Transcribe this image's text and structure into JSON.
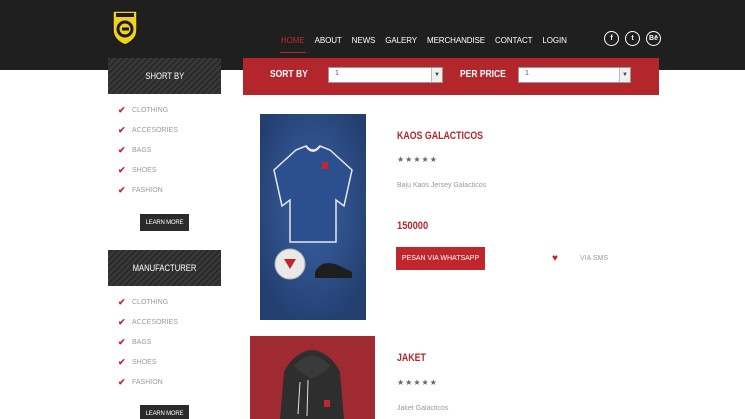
{
  "header": {
    "logo_icon": "shield-logo-icon",
    "nav": [
      {
        "label": "HOME",
        "active": true
      },
      {
        "label": "ABOUT",
        "active": false
      },
      {
        "label": "NEWS",
        "active": false
      },
      {
        "label": "GALERY",
        "active": false
      },
      {
        "label": "MERCHANDISE",
        "active": false
      },
      {
        "label": "CONTACT",
        "active": false
      },
      {
        "label": "LOGIN",
        "active": false
      }
    ],
    "social": [
      {
        "icon": "facebook-icon",
        "glyph": "f"
      },
      {
        "icon": "twitter-icon",
        "glyph": "t"
      },
      {
        "icon": "behance-icon",
        "glyph": "Bē"
      }
    ]
  },
  "sortbar": {
    "sort_label": "SORT BY",
    "sort_value": "1",
    "price_label": "PER PRICE",
    "price_value": "1"
  },
  "sidebar": {
    "short_by": {
      "title": "SHORT BY",
      "items": [
        "CLOTHING",
        "ACCESORIES",
        "BAGS",
        "SHOES",
        "FASHION"
      ],
      "button": "LEARN MORE"
    },
    "manufacturer": {
      "title": "MANUFACTURER",
      "items": [
        "CLOTHING",
        "ACCESORIES",
        "BAGS",
        "SHOES",
        "FASHION"
      ],
      "button": "LEARN MORE"
    }
  },
  "products": [
    {
      "title": "KAOS GALACTICOS",
      "stars": "★★★★★",
      "description": "Baju Kaos Jersey Galacticos",
      "price": "150000",
      "whatsapp_label": "PESAN VIA WHATSAPP",
      "sms_label": "VIA SMS"
    },
    {
      "title": "JAKET",
      "stars": "★★★★★",
      "description": "Jaket Galacticos"
    }
  ],
  "colors": {
    "accent": "#c0272d",
    "header_bg": "#1f1f1f",
    "sidebar_header": "#2b2b2b"
  }
}
